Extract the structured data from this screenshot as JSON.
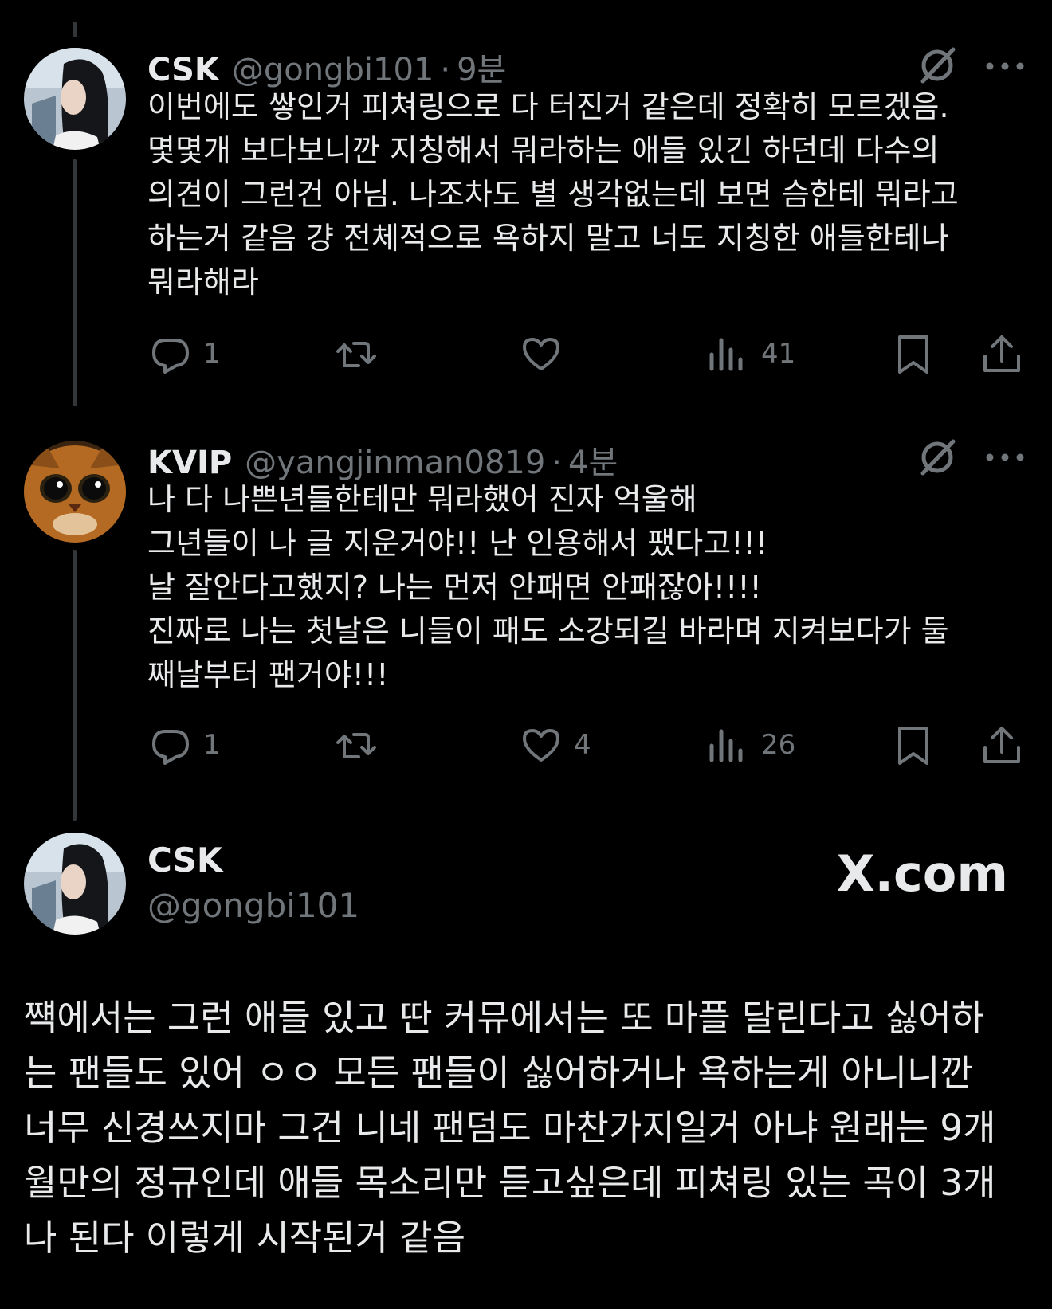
{
  "reply1": {
    "name": "CSK",
    "handle": "@gongbi101",
    "time": "9분",
    "text": "이번에도 쌓인거 피쳐링으로 다 터진거 같은데 정확히 모르겠음.\n몇몇개 보다보니깐 지칭해서 뭐라하는 애들 있긴 하던데 다수의\n의견이 그런건 아님. 나조차도 별 생각없는데 보면 슴한테 뭐라고\n하는거 같음 걍 전체적으로 욕하지 말고 너도 지칭한 애들한테나\n뭐라해라",
    "replies": "1",
    "likes": "",
    "views": "41"
  },
  "reply2": {
    "name": "KVIP",
    "handle": "@yangjinman0819",
    "time": "4분",
    "text": "나 다 나쁜년들한테만 뭐라했어 진자 억울해\n그년들이 나 글 지운거야!! 난 인용해서 팼다고!!!\n날 잘안다고했지? 나는 먼저 안패면 안패잖아!!!!\n진짜로 나는 첫날은 니들이 패도 소강되길 바라며 지켜보다가 둘\n째날부터 팬거야!!!",
    "replies": "1",
    "likes": "4",
    "views": "26"
  },
  "main": {
    "name": "CSK",
    "handle": "@gongbi101",
    "brand": "X.com",
    "text": "쨱에서는 그런 애들 있고 딴 커뮤에서는 또 마플 달린다고 싫어하\n는 팬들도 있어 ㅇㅇ 모든 팬들이 싫어하거나 욕하는게 아니니깐\n너무 신경쓰지마 그건 니네 팬덤도 마찬가지일거 아냐 원래는 9개\n월만의 정규인데 애들 목소리만 듣고싶은데 피쳐링 있는 곡이 3개\n나 된다 이렇게 시작된거 같음"
  },
  "icons": {
    "reply": "reply-icon",
    "retweet": "retweet-icon",
    "like": "heart-icon",
    "views": "views-icon",
    "bookmark": "bookmark-icon",
    "share": "share-icon",
    "grok": "grok-icon",
    "more": "more-icon"
  },
  "colors": {
    "background": "#000000",
    "text": "#e7e9ea",
    "secondary": "#71767b",
    "thread_line": "#333639"
  }
}
